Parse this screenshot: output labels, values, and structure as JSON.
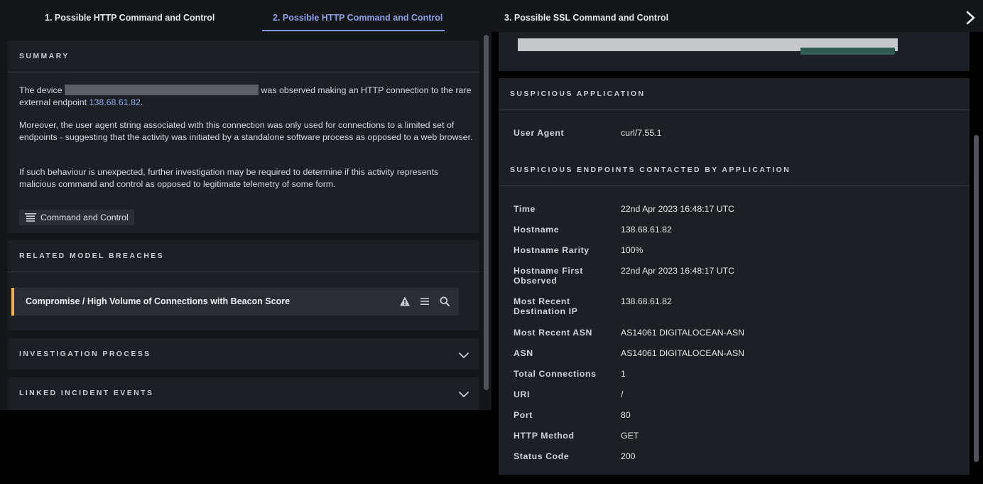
{
  "tabs": [
    {
      "label": "1. Possible HTTP Command and Control",
      "active": false
    },
    {
      "label": "2. Possible HTTP Command and Control",
      "active": true
    },
    {
      "label": "3. Possible SSL Command and Control",
      "active": false
    }
  ],
  "summary": {
    "title": "SUMMARY",
    "p1_before": "The device",
    "p1_after": "was observed making an HTTP connection to the rare external endpoint",
    "endpoint": "138.68.61.82",
    "p1_end": ".",
    "p2": "Moreover, the user agent string associated with this connection was only used for connections to a limited set of endpoints - suggesting that the activity was initiated by a standalone software process as opposed to a web browser.",
    "p3": "If such behaviour is unexpected, further investigation may be required to determine if this activity represents malicious command and control as opposed to legitimate telemetry of some form.",
    "tag": "Command and Control"
  },
  "related": {
    "title": "RELATED MODEL BREACHES",
    "breach_label": "Compromise / High Volume of Connections with Beacon Score"
  },
  "investigation": {
    "title": "INVESTIGATION PROCESS"
  },
  "linked": {
    "title": "LINKED INCIDENT EVENTS"
  },
  "suspicious_app": {
    "title": "SUSPICIOUS APPLICATION",
    "user_agent_key": "User Agent",
    "user_agent_val": "curl/7.55.1"
  },
  "endpoints": {
    "title": "SUSPICIOUS ENDPOINTS CONTACTED BY APPLICATION",
    "rows": [
      {
        "key": "Time",
        "val": "22nd Apr 2023 16:48:17 UTC"
      },
      {
        "key": "Hostname",
        "val": "138.68.61.82"
      },
      {
        "key": "Hostname Rarity",
        "val": "100%"
      },
      {
        "key": "Hostname First Observed",
        "val": "22nd Apr 2023 16:48:17 UTC"
      },
      {
        "key": "Most Recent Destination IP",
        "val": "138.68.61.82"
      },
      {
        "key": "Most Recent ASN",
        "val": "AS14061 DIGITALOCEAN-ASN"
      },
      {
        "key": "ASN",
        "val": "AS14061 DIGITALOCEAN-ASN"
      },
      {
        "key": "Total Connections",
        "val": "1"
      },
      {
        "key": "URI",
        "val": "/"
      },
      {
        "key": "Port",
        "val": "80"
      },
      {
        "key": "HTTP Method",
        "val": "GET"
      },
      {
        "key": "Status Code",
        "val": "200"
      }
    ]
  },
  "colors": {
    "accent": "#7d95e0",
    "breach_bar": "#f0b54a",
    "link": "#93aff0"
  }
}
